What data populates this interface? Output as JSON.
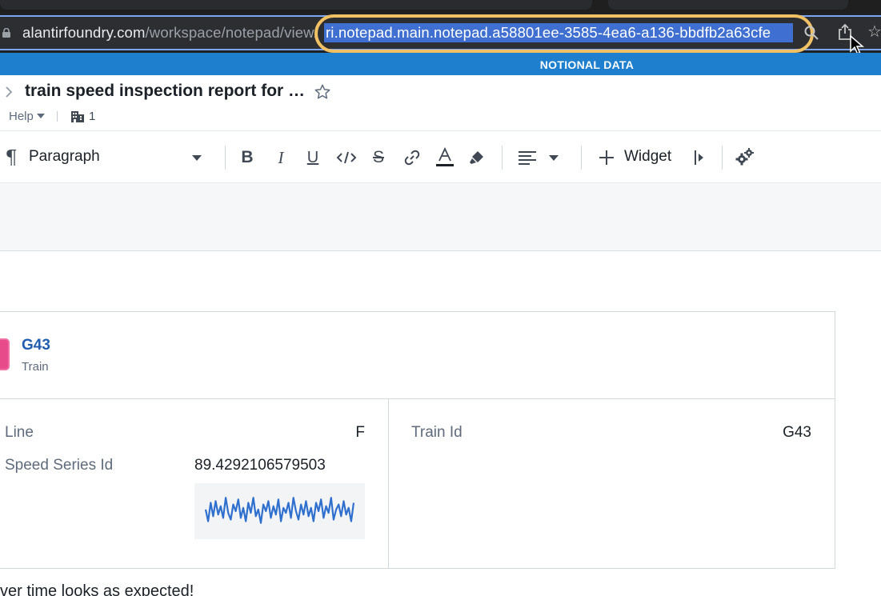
{
  "browser": {
    "url_domain": "alantirfoundry.com",
    "url_path": "/workspace/notepad/view/",
    "url_selected": "ri.notepad.main.notepad.a58801ee-3585-4ea6-a136-bbdfb2a63cfe",
    "highlight_color": "#f0c064",
    "selection_color": "#3f6fd0"
  },
  "banner": {
    "text": "NOTIONAL DATA",
    "color": "#1f7fcf"
  },
  "header": {
    "title": "train speed inspection report for …",
    "help_label": "Help",
    "building_count": "1"
  },
  "toolbar": {
    "paragraph_label": "Paragraph",
    "bold": "B",
    "italic": "I",
    "underline": "U",
    "strike": "S",
    "widget_label": "Widget",
    "icons": [
      "pilcrow-icon",
      "bold-icon",
      "italic-icon",
      "underline-icon",
      "code-icon",
      "strikethrough-icon",
      "link-icon",
      "font-color-icon",
      "highlighter-icon",
      "align-left-icon",
      "plus-icon",
      "caret-right-icon",
      "cogs-icon"
    ]
  },
  "card": {
    "title": "G43",
    "type": "Train",
    "accent_color": "#e84b8a",
    "properties": [
      {
        "label": "Line",
        "value": "F"
      },
      {
        "label": "Speed Series Id",
        "value": "89.4292106579503"
      },
      {
        "label": "Train Id",
        "value": "G43"
      }
    ],
    "sparkline": {
      "color": "#2f6fce",
      "values": [
        0.55,
        0.2,
        0.75,
        0.35,
        0.8,
        0.4,
        0.65,
        0.3,
        0.9,
        0.45,
        0.25,
        0.7,
        0.5,
        0.85,
        0.3,
        0.6,
        0.2,
        0.75,
        0.45,
        0.9,
        0.35,
        0.55,
        0.15,
        0.7,
        0.5,
        0.8,
        0.3,
        0.65,
        0.4,
        0.85,
        0.2,
        0.6,
        0.45,
        0.75,
        0.3,
        0.9,
        0.5,
        0.25,
        0.7,
        0.4,
        0.8,
        0.35,
        0.6,
        0.2,
        0.75,
        0.5,
        0.85,
        0.3,
        0.65,
        0.45,
        0.9,
        0.25,
        0.55,
        0.7,
        0.35,
        0.8,
        0.4,
        0.6,
        0.2,
        0.75
      ]
    }
  },
  "footer": {
    "text": "ver time looks as expected!"
  }
}
